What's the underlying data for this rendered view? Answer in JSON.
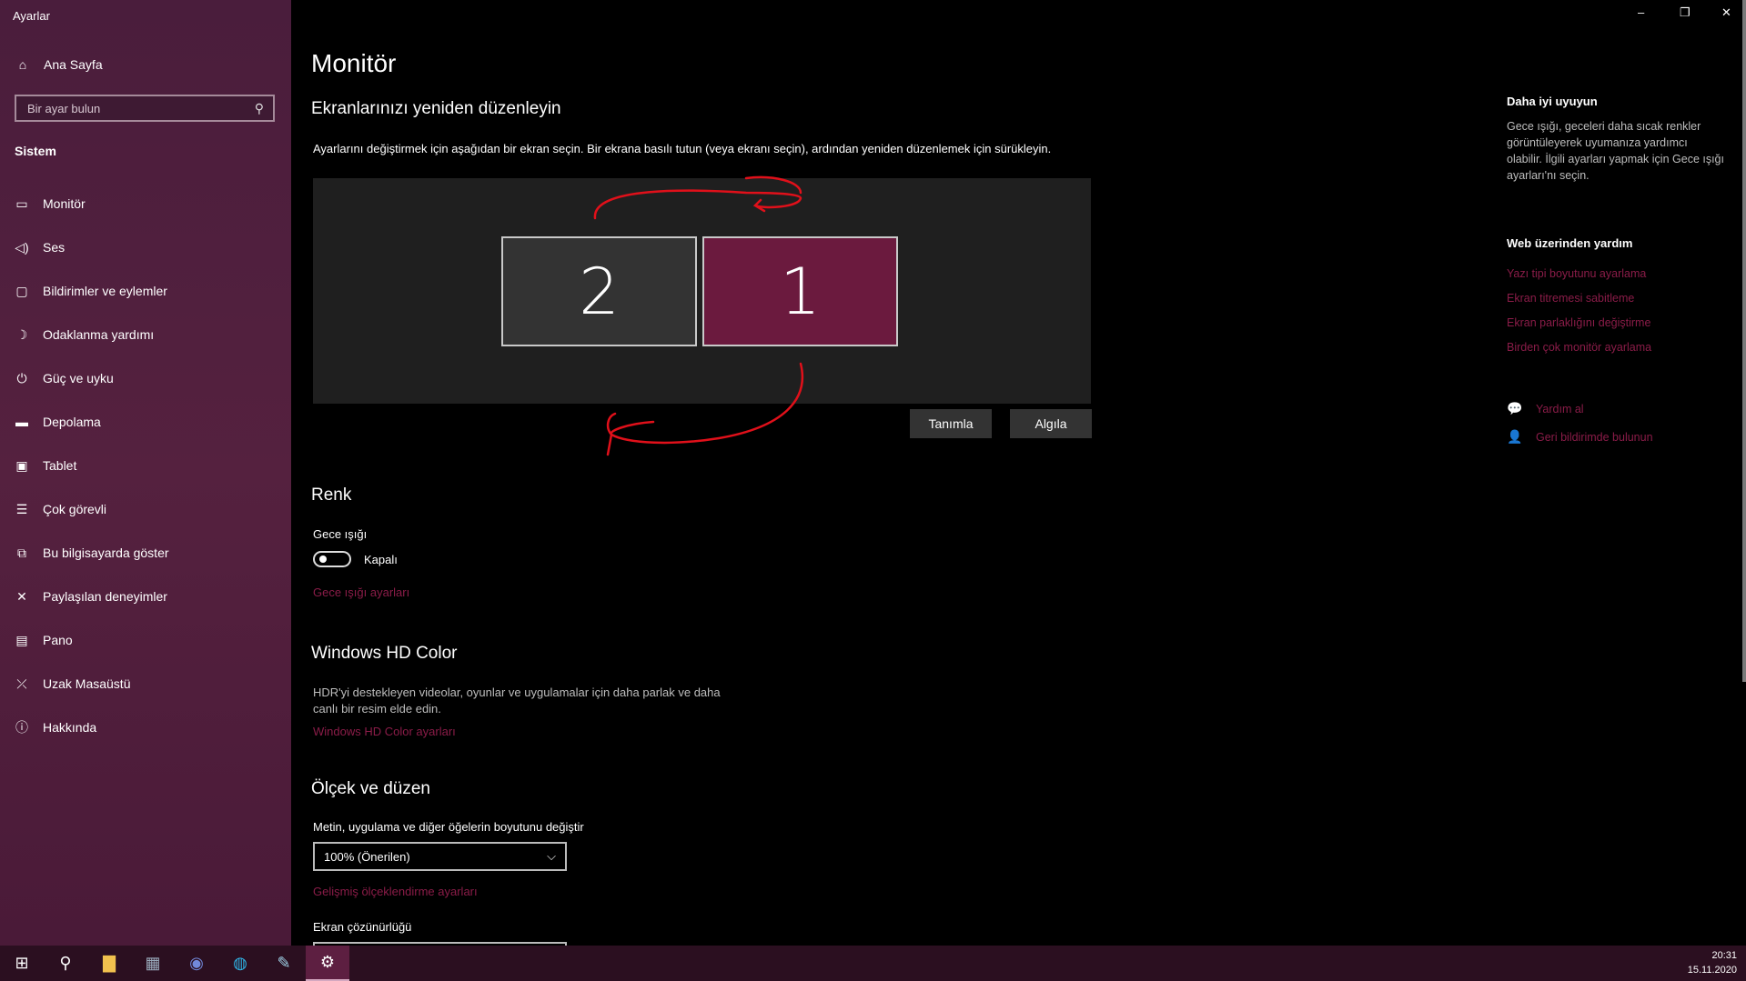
{
  "window": {
    "title": "Ayarlar",
    "minimize": "–",
    "restore": "❐",
    "close": "✕"
  },
  "sidebar": {
    "home": {
      "label": "Ana Sayfa",
      "icon": "home-icon"
    },
    "search_placeholder": "Bir ayar bulun",
    "section": "Sistem",
    "items": [
      {
        "label": "Monitör",
        "icon": "monitor-icon",
        "glyph": "▭"
      },
      {
        "label": "Ses",
        "icon": "speaker-icon",
        "glyph": "🔈"
      },
      {
        "label": "Bildirimler ve eylemler",
        "icon": "notification-icon",
        "glyph": "▢"
      },
      {
        "label": "Odaklanma yardımı",
        "icon": "moon-icon",
        "glyph": "☽"
      },
      {
        "label": "Güç ve uyku",
        "icon": "power-icon",
        "glyph": "⏻"
      },
      {
        "label": "Depolama",
        "icon": "storage-icon",
        "glyph": "▬"
      },
      {
        "label": "Tablet",
        "icon": "tablet-icon",
        "glyph": "▣"
      },
      {
        "label": "Çok görevli",
        "icon": "multitask-icon",
        "glyph": "☰"
      },
      {
        "label": "Bu bilgisayarda göster",
        "icon": "project-icon",
        "glyph": "⧉"
      },
      {
        "label": "Paylaşılan deneyimler",
        "icon": "shared-icon",
        "glyph": "✕"
      },
      {
        "label": "Pano",
        "icon": "clipboard-icon",
        "glyph": "📋"
      },
      {
        "label": "Uzak Masaüstü",
        "icon": "remote-icon",
        "glyph": "⤫"
      },
      {
        "label": "Hakkında",
        "icon": "info-icon",
        "glyph": "ⓘ"
      }
    ]
  },
  "main": {
    "title": "Monitör",
    "rearrange": {
      "heading": "Ekranlarınızı yeniden düzenleyin",
      "description": "Ayarlarını değiştirmek için aşağıdan bir ekran seçin. Bir ekrana basılı tutun (veya ekranı seçin), ardından yeniden düzenlemek için sürükleyin.",
      "monitors": [
        "2",
        "1"
      ],
      "identify_label": "Tanımla",
      "detect_label": "Algıla"
    },
    "color": {
      "heading": "Renk",
      "night_light_label": "Gece ışığı",
      "toggle_state": "Kapalı",
      "night_light_link": "Gece ışığı ayarları"
    },
    "hd": {
      "heading": "Windows HD Color",
      "description": "HDR'yi destekleyen videolar, oyunlar ve uygulamalar için daha parlak ve daha canlı bir resim elde edin.",
      "link": "Windows HD Color ayarları"
    },
    "scale": {
      "heading": "Ölçek ve düzen",
      "size_label": "Metin, uygulama ve diğer öğelerin boyutunu değiştir",
      "size_value": "100% (Önerilen)",
      "advanced_link": "Gelişmiş ölçeklendirme ayarları",
      "resolution_label": "Ekran çözünürlüğü"
    }
  },
  "right": {
    "sleep_heading": "Daha iyi uyuyun",
    "sleep_text": "Gece ışığı, geceleri daha sıcak renkler görüntüleyerek uyumanıza yardımcı olabilir. İlgili ayarları yapmak için Gece ışığı ayarları'nı seçin.",
    "web_heading": "Web üzerinden yardım",
    "web_links": [
      "Yazı tipi boyutunu ayarlama",
      "Ekran titremesi sabitleme",
      "Ekran parlaklığını değiştirme",
      "Birden çok monitör ayarlama"
    ],
    "help": "Yardım al",
    "feedback": "Geri bildirimde bulunun"
  },
  "taskbar": {
    "time": "20:31",
    "date": "15.11.2020",
    "accent": "#5d1f41"
  }
}
